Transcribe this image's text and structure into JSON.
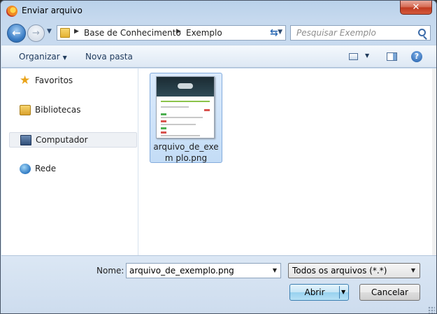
{
  "window": {
    "title": "Enviar arquivo",
    "close_label": "✕"
  },
  "nav": {
    "back_icon": "back-arrow-icon",
    "forward_icon": "forward-arrow-icon",
    "breadcrumb": [
      "Base de Conhecimento",
      "Exemplo"
    ],
    "search_placeholder": "Pesquisar Exemplo"
  },
  "toolbar": {
    "organize_label": "Organizar",
    "new_folder_label": "Nova pasta"
  },
  "sidebar": {
    "items": [
      {
        "label": "Favoritos",
        "icon": "star-icon"
      },
      {
        "label": "Bibliotecas",
        "icon": "library-icon"
      },
      {
        "label": "Computador",
        "icon": "computer-icon",
        "selected": true
      },
      {
        "label": "Rede",
        "icon": "network-icon"
      }
    ]
  },
  "files": [
    {
      "name": "arquivo_de_exemplo.png",
      "name_wrapped": "arquivo_de_exem plo.png",
      "selected": true
    }
  ],
  "footer": {
    "name_label": "Nome:",
    "name_value": "arquivo_de_exemplo.png",
    "file_type": "Todos os arquivos (*.*)",
    "open_label": "Abrir",
    "cancel_label": "Cancelar"
  },
  "colors": {
    "accent": "#3c7fb1",
    "selection": "#cce4f7",
    "close_red": "#c0391f"
  }
}
